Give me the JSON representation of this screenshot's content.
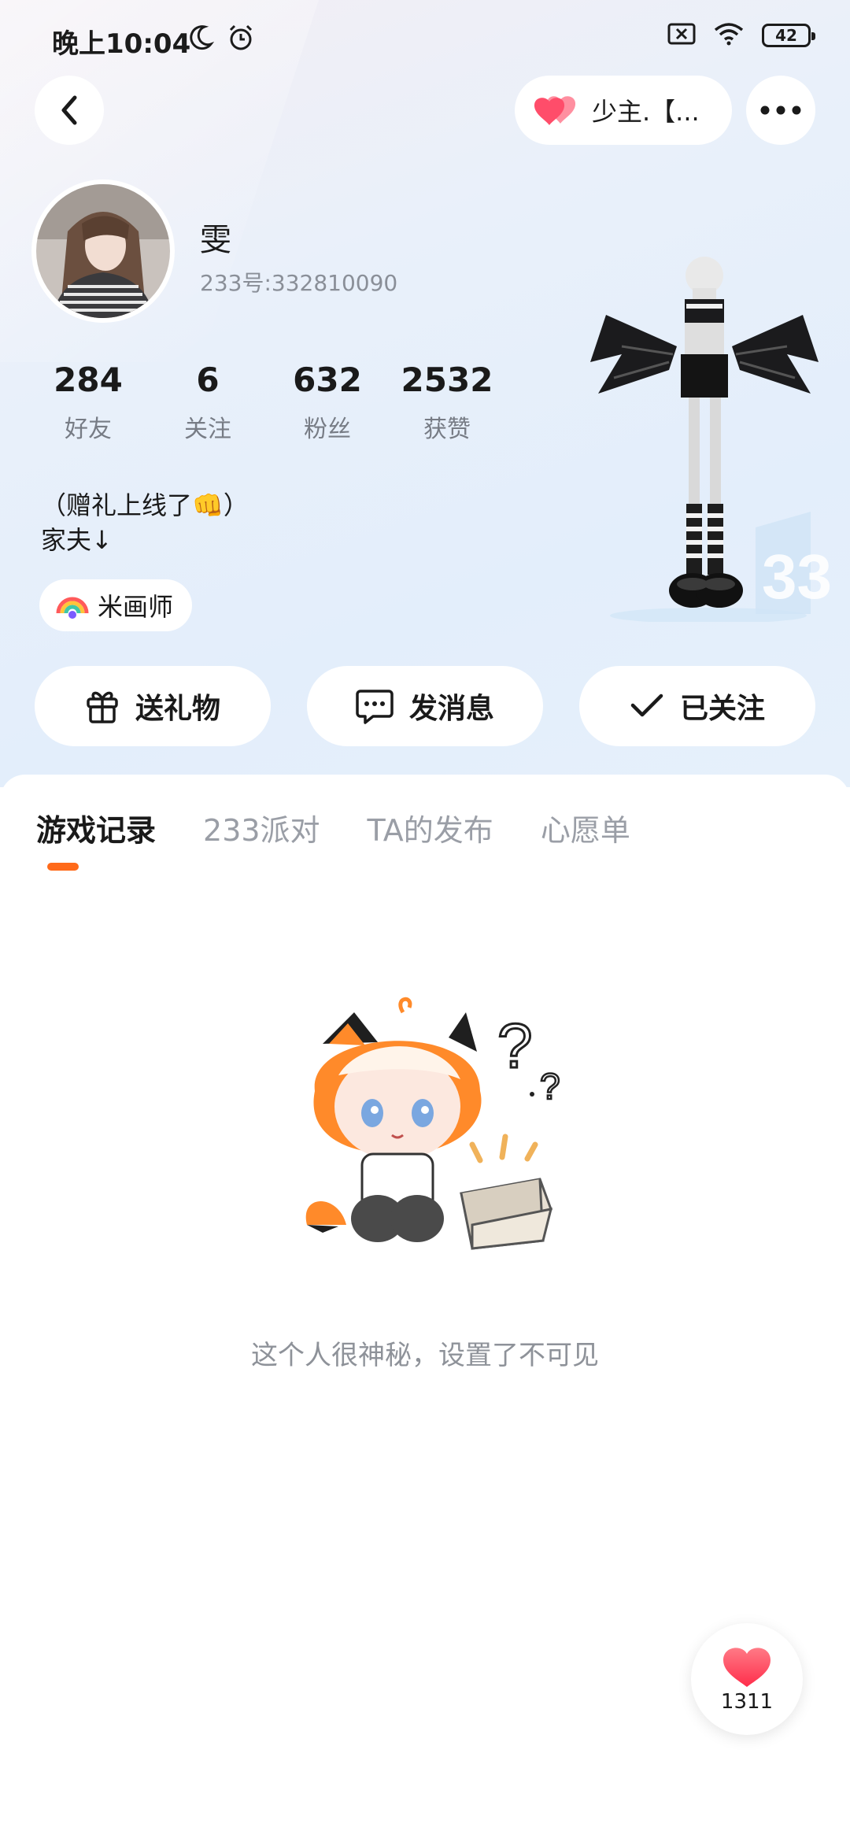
{
  "status_bar": {
    "time": "晚上10:04",
    "battery": "42"
  },
  "header": {
    "couple_label": "少主.【..."
  },
  "profile": {
    "name": "雯",
    "id_text": "233号:332810090",
    "bio_line1": "（赠礼上线了👊）",
    "bio_line2": "家夫↓",
    "badge_label": "米画师"
  },
  "stats": [
    {
      "value": "284",
      "label": "好友"
    },
    {
      "value": "6",
      "label": "关注"
    },
    {
      "value": "632",
      "label": "粉丝"
    },
    {
      "value": "2532",
      "label": "获赞"
    }
  ],
  "actions": {
    "gift_label": "送礼物",
    "message_label": "发消息",
    "follow_label": "已关注"
  },
  "tabs": [
    {
      "label": "游戏记录",
      "active": true
    },
    {
      "label": "233派对",
      "active": false
    },
    {
      "label": "TA的发布",
      "active": false
    },
    {
      "label": "心愿单",
      "active": false
    }
  ],
  "empty_state": {
    "text": "这个人很神秘，设置了不可见"
  },
  "like_button": {
    "count": "1311"
  },
  "colors": {
    "accent": "#ff6a1a",
    "heart": "#ff4d6a"
  }
}
